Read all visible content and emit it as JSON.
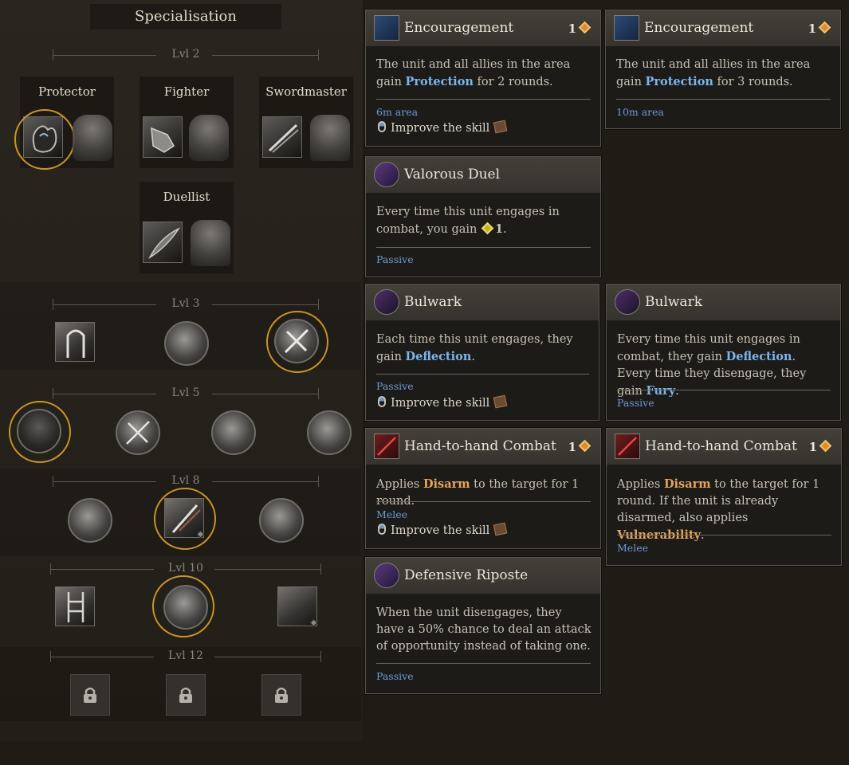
{
  "spec": {
    "title": "Specialisation",
    "levels": [
      "Lvl 2",
      "Lvl 3",
      "Lvl 5",
      "Lvl 8",
      "Lvl 10",
      "Lvl 12"
    ],
    "classes": [
      "Protector",
      "Fighter",
      "Swordmaster",
      "Duellist"
    ]
  },
  "tooltips": {
    "enc1": {
      "name": "Encouragement",
      "cost": "1",
      "desc_pre": "The unit and all allies in the area gain ",
      "desc_kw": "Protection",
      "desc_post": " for 2 rounds.",
      "tag": "6m area",
      "improve": "Improve the skill"
    },
    "enc2": {
      "name": "Encouragement",
      "cost": "1",
      "desc_pre": "The unit and all allies in the area gain ",
      "desc_kw": "Protection",
      "desc_post": " for 3 rounds.",
      "tag": "10m area"
    },
    "valorous": {
      "name": "Valorous Duel",
      "desc_pre": "Every time this unit engages in combat, you gain ",
      "desc_num": "1",
      "desc_post": ".",
      "tag": "Passive"
    },
    "bulwark1": {
      "name": "Bulwark",
      "desc_pre": "Each time this unit engages, they gain ",
      "desc_kw": "Deflection",
      "desc_post": ".",
      "tag": "Passive",
      "improve": "Improve the skill"
    },
    "bulwark2": {
      "name": "Bulwark",
      "line1_pre": "Every time this unit engages in combat, they gain ",
      "line1_kw": "Deflection",
      "line1_post": ".",
      "line2_pre": "Every time they disengage, they gain ",
      "line2_kw": "Fury",
      "line2_post": ".",
      "tag": "Passive"
    },
    "h2h1": {
      "name": "Hand-to-hand Combat",
      "cost": "1",
      "desc_pre": "Applies ",
      "desc_kw": "Disarm",
      "desc_post": " to the target for 1 round.",
      "tag": "Melee",
      "improve": "Improve the skill"
    },
    "h2h2": {
      "name": "Hand-to-hand Combat",
      "cost": "1",
      "desc_pre": "Applies ",
      "desc_kw": "Disarm",
      "desc_post": " to the target for 1 round. If the unit is already disarmed, also applies ",
      "desc_kw2": "Vulnerability",
      "desc_post2": ".",
      "tag": "Melee"
    },
    "riposte": {
      "name": "Defensive Riposte",
      "desc": "When the unit disengages, they have a 50% chance to deal an attack of opportunity instead of taking one.",
      "tag": "Passive"
    }
  },
  "colors": {
    "accent_gold": "#c9971f",
    "keyword_blue": "#7ab6ee",
    "keyword_orange": "#e3a65a",
    "tag_blue": "#6c9bd4"
  },
  "icons": [
    "shield-hand-icon",
    "armor-icon",
    "boot-icon",
    "sword-icon",
    "coat-icon",
    "feather-icon",
    "lock-icon",
    "mouse-icon",
    "book-icon",
    "gem-icon"
  ]
}
